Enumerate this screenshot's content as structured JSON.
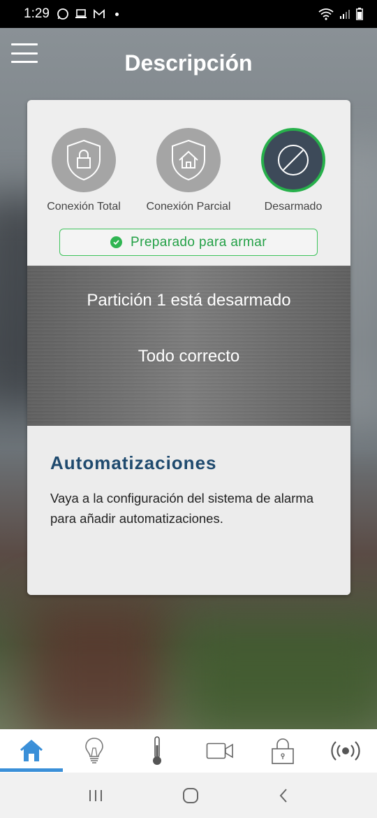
{
  "status_bar": {
    "time": "1:29",
    "notification_icons": [
      "whatsapp-icon",
      "laptop-icon",
      "gmail-icon"
    ],
    "system_icons": [
      "wifi-icon",
      "signal-icon",
      "battery-icon"
    ]
  },
  "header": {
    "title": "Descripción"
  },
  "modes": [
    {
      "label": "Conexión Total",
      "icon": "shield-lock-icon",
      "active": false
    },
    {
      "label": "Conexión Parcial",
      "icon": "shield-home-icon",
      "active": false
    },
    {
      "label": "Desarmado",
      "icon": "disarmed-icon",
      "active": true
    }
  ],
  "ready_status": {
    "label": "Preparado para armar",
    "color": "#23a046"
  },
  "partition": {
    "status": "Partición 1 está desarmado",
    "detail": "Todo correcto"
  },
  "automations": {
    "title": "Automatizaciones",
    "description": "Vaya a la configuración del sistema de alarma para añadir automatizaciones."
  },
  "tabs": [
    {
      "icon": "home-icon",
      "active": true
    },
    {
      "icon": "lightbulb-icon",
      "active": false
    },
    {
      "icon": "thermometer-icon",
      "active": false
    },
    {
      "icon": "video-camera-icon",
      "active": false
    },
    {
      "icon": "padlock-icon",
      "active": false
    },
    {
      "icon": "broadcast-icon",
      "active": false
    }
  ],
  "colors": {
    "accent": "#3a8fd8",
    "ready_green": "#2fb552",
    "title_blue": "#1f4a6e",
    "active_mode_bg": "#3d4a59"
  }
}
